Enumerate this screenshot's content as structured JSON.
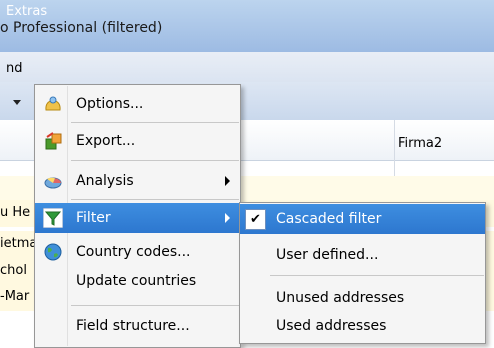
{
  "window": {
    "title": "o Professional (filtered)"
  },
  "menubar": {
    "partial_item": "nd",
    "extras": "Extras"
  },
  "grid": {
    "column_firma2": "Firma2",
    "rows": [
      "u He",
      "ietma",
      "chol",
      "-Mar"
    ]
  },
  "extras_menu": {
    "items": [
      {
        "label": "Options...",
        "icon": "options-icon"
      },
      {
        "label": "Export...",
        "icon": "export-icon"
      },
      {
        "label": "Analysis",
        "icon": "analysis-icon"
      },
      {
        "label": "Filter",
        "icon": "filter-icon"
      },
      {
        "label": "Country codes...",
        "icon": "globe-icon"
      },
      {
        "label": "Update countries",
        "icon": ""
      },
      {
        "label": "Field structure...",
        "icon": ""
      }
    ]
  },
  "filter_submenu": {
    "items": [
      {
        "label": "Cascaded filter",
        "checked": true
      },
      {
        "label": "User defined..."
      },
      {
        "label": "Unused addresses"
      },
      {
        "label": "Used addresses"
      }
    ]
  },
  "colors": {
    "highlight": "#2d77cf",
    "titlebar": "#9dbbe3"
  }
}
